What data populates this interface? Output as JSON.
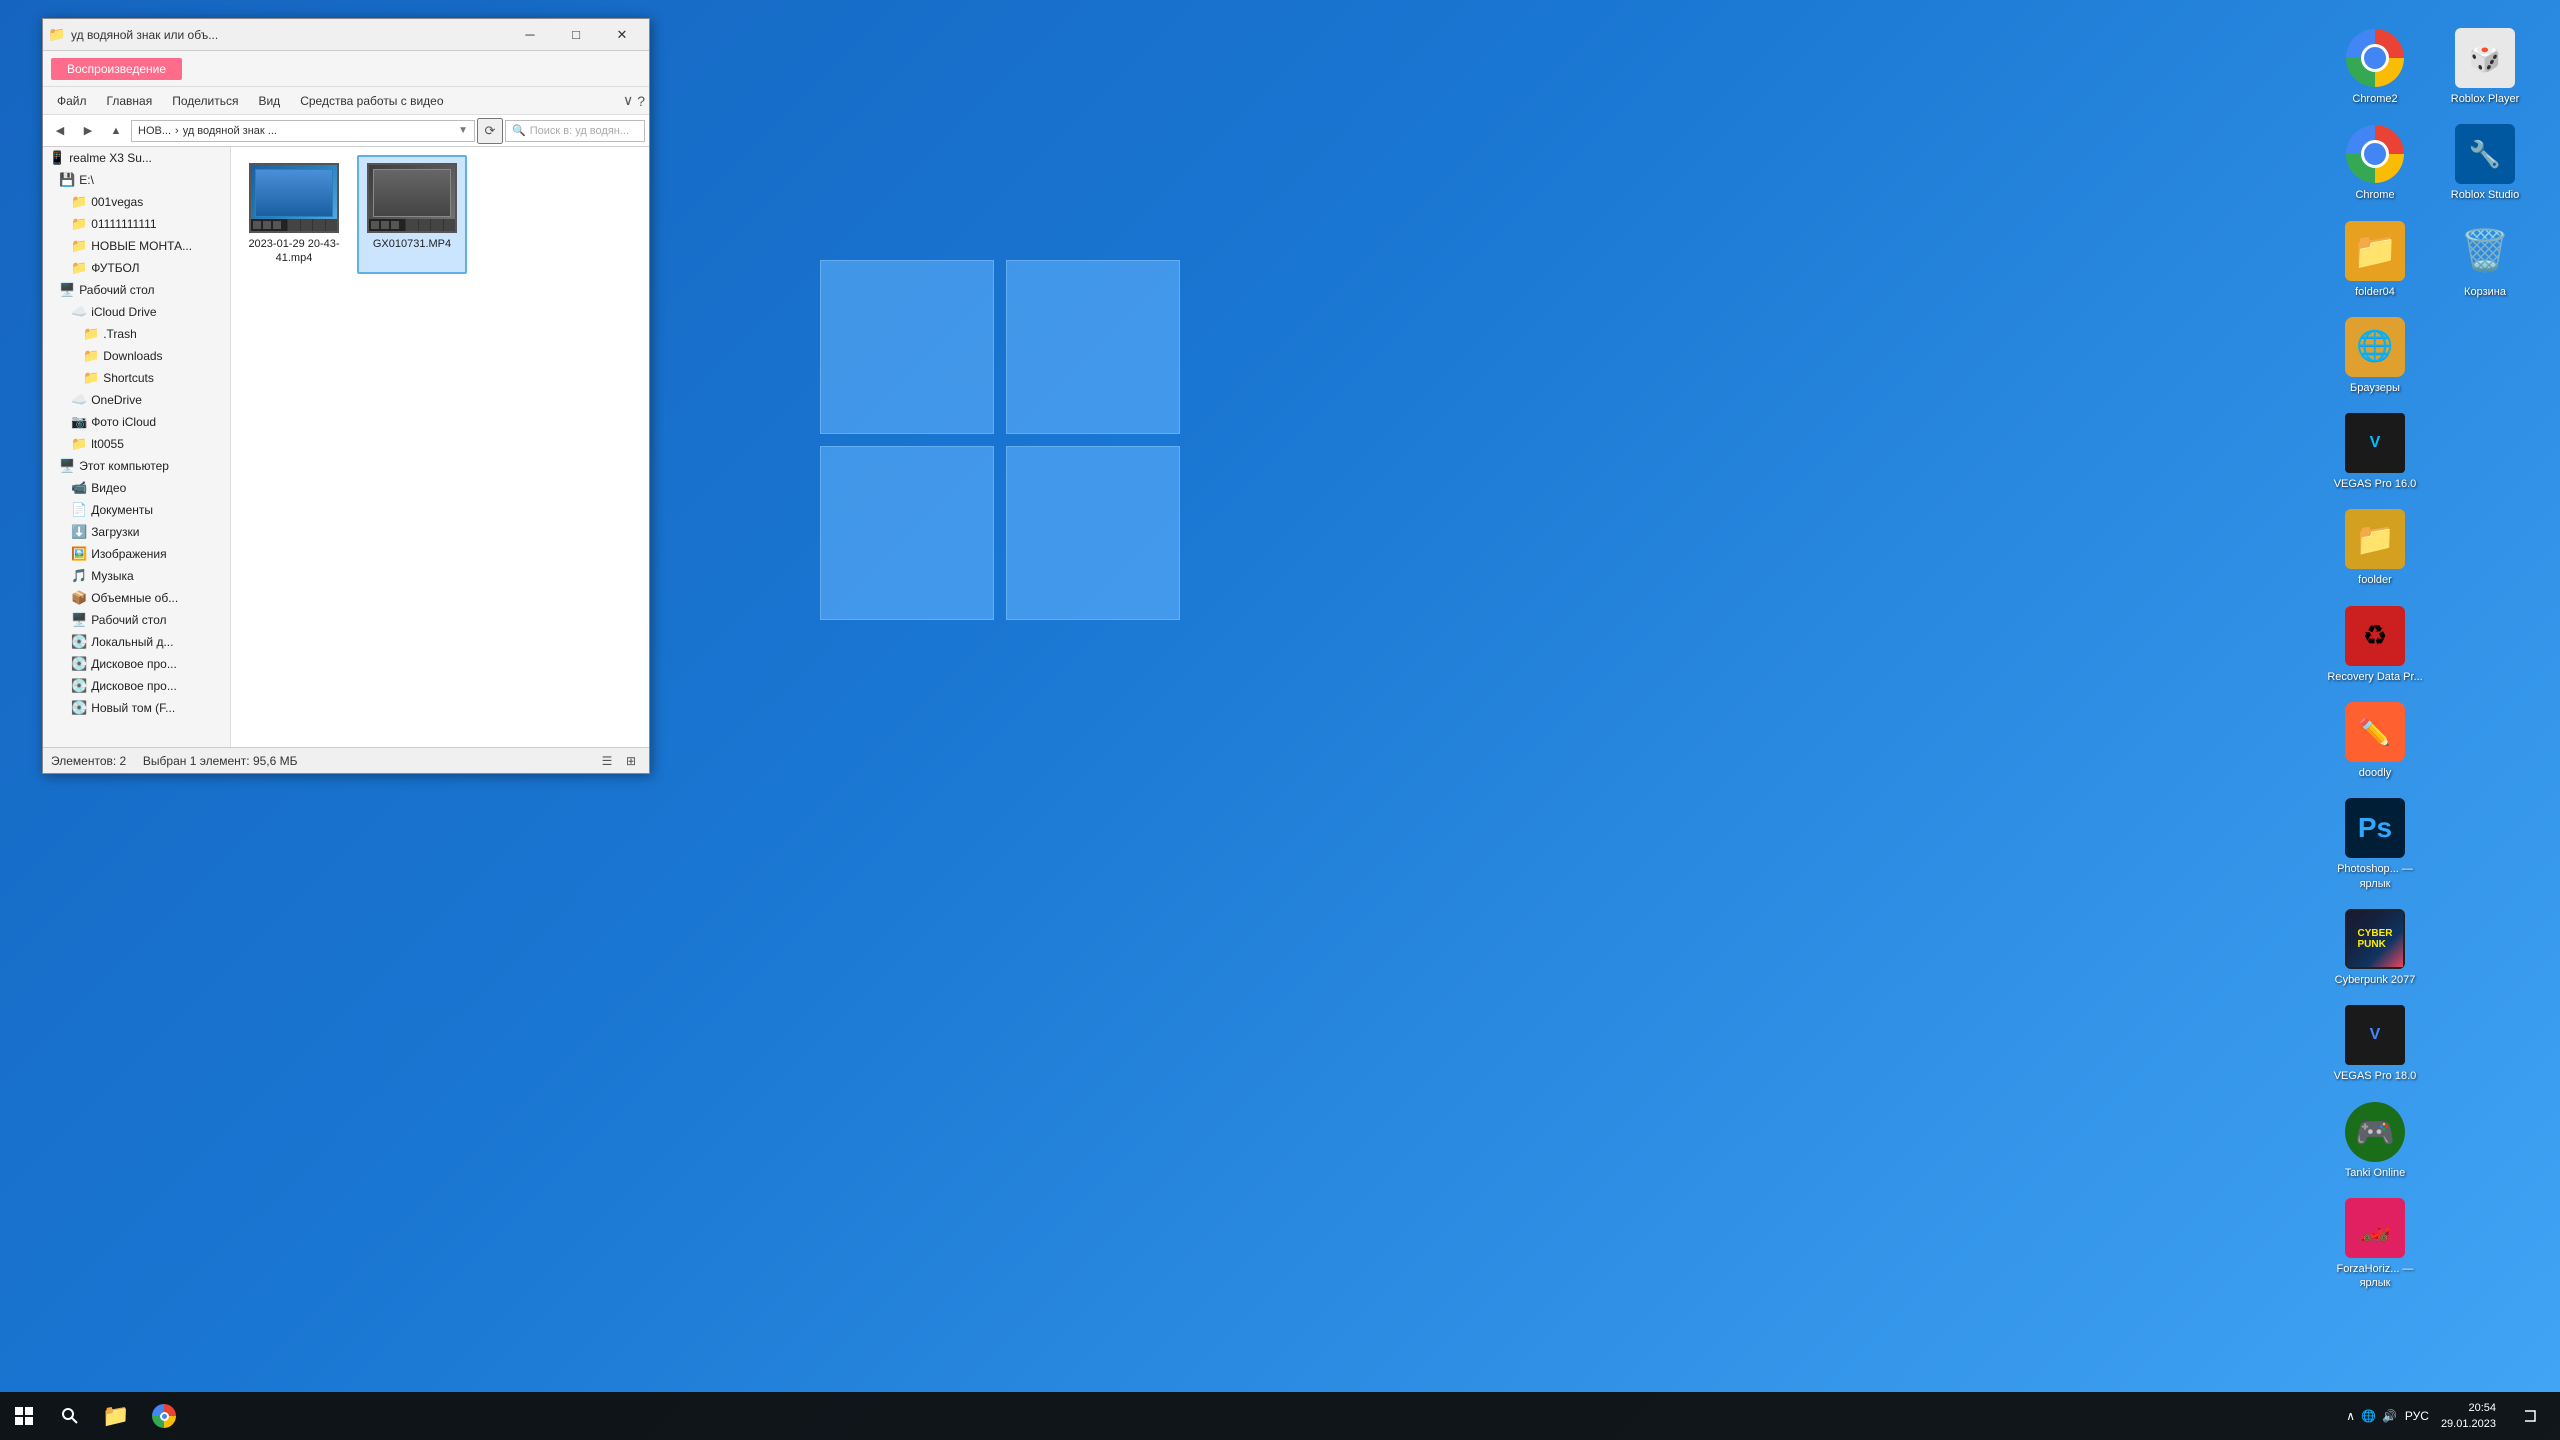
{
  "desktop": {
    "background": "#1565c0"
  },
  "taskbar": {
    "time": "20:54",
    "date": "29.01.2023",
    "language": "РУС",
    "start_label": "⊞",
    "search_label": "🔍"
  },
  "explorer": {
    "title": "уд водяной знак ...",
    "title_full": "уд водяной знак или объ...",
    "play_button": "Воспроизведение",
    "menu": {
      "file": "Файл",
      "home": "Главная",
      "share": "Поделиться",
      "view": "Вид",
      "tools": "Средства работы с видео"
    },
    "address": {
      "path_parts": [
        "НОВ...",
        "уд водяной знак ..."
      ],
      "search_placeholder": "Поиск в: уд водян..."
    },
    "nav_tree": {
      "items": [
        {
          "label": "realme X3 Su...",
          "icon": "📱",
          "indent": 0
        },
        {
          "label": "E:\\",
          "icon": "💾",
          "indent": 1
        },
        {
          "label": "001vegas",
          "icon": "📁",
          "indent": 2
        },
        {
          "label": "01111111111",
          "icon": "📁",
          "indent": 2
        },
        {
          "label": "НОВЫЕ МОНТА...",
          "icon": "📁",
          "indent": 2
        },
        {
          "label": "ФУТБОЛ",
          "icon": "📁",
          "indent": 2
        },
        {
          "label": "Рабочий стол",
          "icon": "🖥️",
          "indent": 1
        },
        {
          "label": "iCloud Drive",
          "icon": "☁️",
          "indent": 2
        },
        {
          "label": ".Trash",
          "icon": "📁",
          "indent": 3
        },
        {
          "label": "Downloads",
          "icon": "📁",
          "indent": 3
        },
        {
          "label": "Shortcuts",
          "icon": "📁",
          "indent": 3
        },
        {
          "label": "OneDrive",
          "icon": "☁️",
          "indent": 2
        },
        {
          "label": "Фото iCloud",
          "icon": "📷",
          "indent": 2
        },
        {
          "label": "lt0055",
          "icon": "📁",
          "indent": 2
        },
        {
          "label": "Этот компьютер",
          "icon": "🖥️",
          "indent": 1
        },
        {
          "label": "Видео",
          "icon": "📹",
          "indent": 2
        },
        {
          "label": "Документы",
          "icon": "📄",
          "indent": 2
        },
        {
          "label": "Загрузки",
          "icon": "⬇️",
          "indent": 2
        },
        {
          "label": "Изображения",
          "icon": "🖼️",
          "indent": 2
        },
        {
          "label": "Музыка",
          "icon": "🎵",
          "indent": 2
        },
        {
          "label": "Объемные об...",
          "icon": "📦",
          "indent": 2
        },
        {
          "label": "Рабочий стол",
          "icon": "🖥️",
          "indent": 2
        },
        {
          "label": "Локальный д...",
          "icon": "💽",
          "indent": 2
        },
        {
          "label": "Дисковое про...",
          "icon": "💽",
          "indent": 2
        },
        {
          "label": "Дисковое про...",
          "icon": "💽",
          "indent": 2
        },
        {
          "label": "Новый том (F...",
          "icon": "💽",
          "indent": 2
        }
      ]
    },
    "files": [
      {
        "name": "2023-01-29 20-43-41.mp4",
        "type": "video",
        "thumb": "blue",
        "selected": false
      },
      {
        "name": "GX010731.MP4",
        "type": "video",
        "thumb": "dark",
        "selected": true
      }
    ],
    "status": {
      "items_count": "Элементов: 2",
      "selected_info": "Выбран 1 элемент: 95,6 МБ"
    }
  },
  "desktop_icons": [
    {
      "label": "Chrome2",
      "type": "chrome",
      "row": 1,
      "col": 1
    },
    {
      "label": "Chrome",
      "type": "chrome",
      "row": 1,
      "col": 2
    },
    {
      "label": "folder04",
      "type": "folder",
      "row": 1,
      "col": 3
    },
    {
      "label": "Браузеры",
      "type": "folder_special",
      "row": 1,
      "col": 4
    },
    {
      "label": "VEGAS Pro\n16.0",
      "type": "vegas",
      "row": 1,
      "col": 5
    },
    {
      "label": "foolder",
      "type": "folder",
      "row": 2,
      "col": 1
    },
    {
      "label": "Recovery\nData Pr...",
      "type": "recovery",
      "row": 2,
      "col": 2
    },
    {
      "label": "doodly",
      "type": "doodly",
      "row": 2,
      "col": 3
    },
    {
      "label": "Photoshop...\n— ярлык",
      "type": "ps",
      "row": 3,
      "col": 1
    },
    {
      "label": "Cyberpunk\n2077",
      "type": "game",
      "row": 4,
      "col": 1
    },
    {
      "label": "VEGAS Pro\n18.0",
      "type": "vegas2",
      "row": 4,
      "col": 2
    },
    {
      "label": "Tanki Online",
      "type": "tanki",
      "row": 5,
      "col": 1
    },
    {
      "label": "ForzaHoriz...\n— ярлык",
      "type": "forza",
      "row": 5,
      "col": 2
    },
    {
      "label": "Roblox Player",
      "type": "roblox",
      "row": 6,
      "col": 1
    },
    {
      "label": "Roblox Studio",
      "type": "roblox2",
      "row": 6,
      "col": 2
    },
    {
      "label": "Корзина",
      "type": "recycle",
      "row": 7,
      "col": 1
    }
  ]
}
